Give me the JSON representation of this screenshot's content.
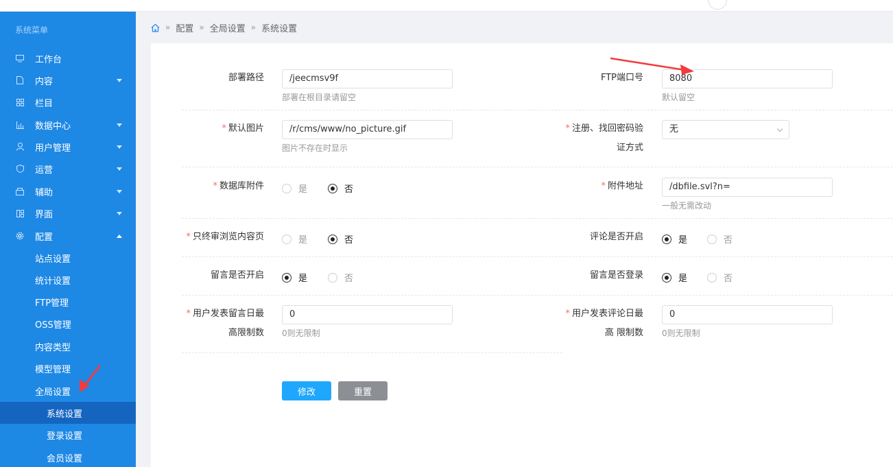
{
  "sidebar": {
    "title": "系统菜单",
    "items": [
      {
        "label": "工作台"
      },
      {
        "label": "内容"
      },
      {
        "label": "栏目"
      },
      {
        "label": "数据中心"
      },
      {
        "label": "用户管理"
      },
      {
        "label": "运营"
      },
      {
        "label": "辅助"
      },
      {
        "label": "界面"
      },
      {
        "label": "配置"
      }
    ],
    "config_sub": [
      {
        "label": "站点设置"
      },
      {
        "label": "统计设置"
      },
      {
        "label": "FTP管理"
      },
      {
        "label": "OSS管理"
      },
      {
        "label": "内容类型"
      },
      {
        "label": "模型管理"
      },
      {
        "label": "全局设置"
      }
    ],
    "global_sub": [
      {
        "label": "系统设置"
      },
      {
        "label": "登录设置"
      },
      {
        "label": "会员设置"
      }
    ]
  },
  "breadcrumb": [
    "配置",
    "全局设置",
    "系统设置"
  ],
  "form": {
    "deploy_path": {
      "label": "部署路径",
      "value": "/jeecmsv9f",
      "hint": "部署在根目录请留空"
    },
    "ftp_port": {
      "label": "FTP端口号",
      "value": "8080",
      "hint": "默认留空"
    },
    "default_image": {
      "label": "默认图片",
      "value": "/r/cms/www/no_picture.gif",
      "hint": "图片不存在时显示"
    },
    "verify_method": {
      "label_line1": "注册、找回密码验",
      "label_line2": "证方式",
      "value": "无"
    },
    "db_attachment": {
      "label": "数据库附件",
      "yes": "是",
      "no": "否"
    },
    "attachment_url": {
      "label": "附件地址",
      "value": "/dbfile.svl?n=",
      "hint": "一般无需改动"
    },
    "terminal_browse": {
      "label": "只终审浏览内容页",
      "yes": "是",
      "no": "否"
    },
    "comment_open": {
      "label": "评论是否开启",
      "yes": "是",
      "no": "否"
    },
    "message_open": {
      "label": "留言是否开启",
      "yes": "是",
      "no": "否"
    },
    "message_login": {
      "label": "留言是否登录",
      "yes": "是",
      "no": "否"
    },
    "user_msg_limit": {
      "label_line1": "用户发表留言日最",
      "label_line2": "高限制数",
      "value": "0",
      "hint": "0则无限制"
    },
    "user_comment_limit": {
      "label_line1": "用户发表评论日最",
      "label_line2": "高 限制数",
      "value": "0",
      "hint": "0则无限制"
    },
    "required_mark": "*"
  },
  "buttons": {
    "submit": "修改",
    "reset": "重置"
  },
  "colors": {
    "sidebar": "#1e88e5",
    "active": "#1565c0",
    "primary": "#1ea7fd",
    "reset": "#8c8f94",
    "arrow": "#f23b3b"
  }
}
